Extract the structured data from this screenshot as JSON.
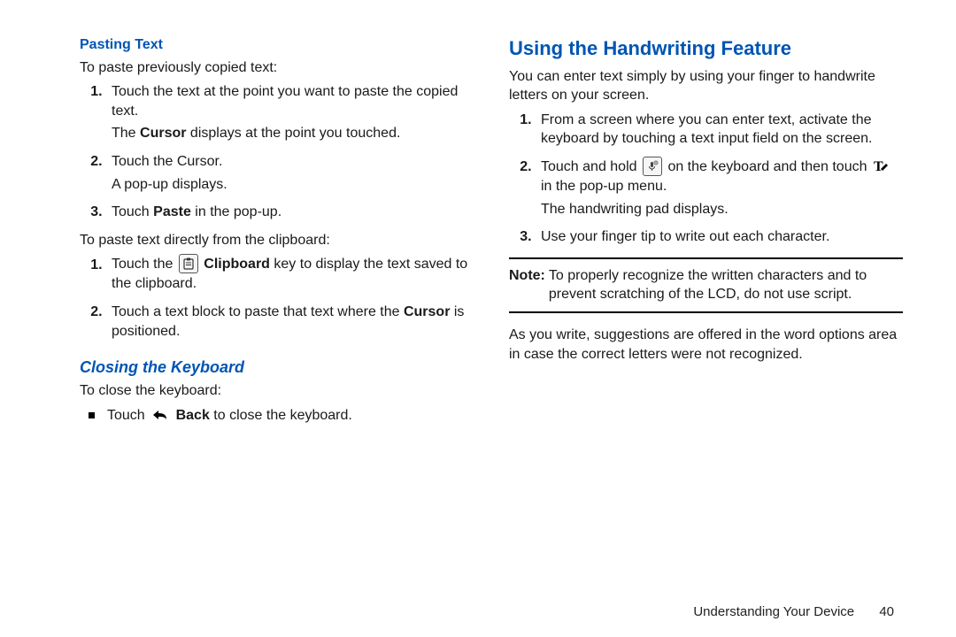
{
  "left": {
    "heading_pasting": "Pasting Text",
    "pasting_intro": "To paste previously copied text:",
    "pasting_list": {
      "i1a": "Touch the text at the point you want to paste the copied text.",
      "i1b_pre": "The ",
      "i1b_bold": "Cursor",
      "i1b_post": " displays at the point you touched.",
      "i2a": "Touch the Cursor.",
      "i2b": "A pop-up displays.",
      "i3_pre": "Touch ",
      "i3_bold": "Paste",
      "i3_post": " in the pop-up."
    },
    "clipboard_intro": "To paste text directly from the clipboard:",
    "clipboard_list": {
      "i1_pre": "Touch the ",
      "i1_bold": " Clipboard",
      "i1_post": " key to display the text saved to the clipboard.",
      "i2_pre": "Touch a text block to paste that text where the ",
      "i2_bold": "Cursor",
      "i2_post": " is positioned."
    },
    "heading_closing": "Closing the Keyboard",
    "closing_intro": "To close the keyboard:",
    "closing_bullet_pre": "Touch ",
    "closing_bullet_bold": " Back",
    "closing_bullet_post": " to close the keyboard."
  },
  "right": {
    "heading_handwriting": "Using the Handwriting Feature",
    "hw_intro": "You can enter text simply by using your finger to handwrite letters on your screen.",
    "hw_list": {
      "i1": "From a screen where you can enter text, activate the keyboard by touching a text input field on the screen.",
      "i2_pre": "Touch and hold ",
      "i2_mid": " on the keyboard and then touch ",
      "i2_post": " in the pop-up menu.",
      "i2_sub": "The handwriting pad displays.",
      "i3": "Use your finger tip to write out each character."
    },
    "note_label": "Note:",
    "note_body": " To properly recognize the written characters and to prevent scratching of the LCD, do not use script.",
    "hw_outro": "As you write, suggestions are offered in the word options area in case the correct letters were not recognized."
  },
  "footer": {
    "section": "Understanding Your Device",
    "page": "40"
  }
}
